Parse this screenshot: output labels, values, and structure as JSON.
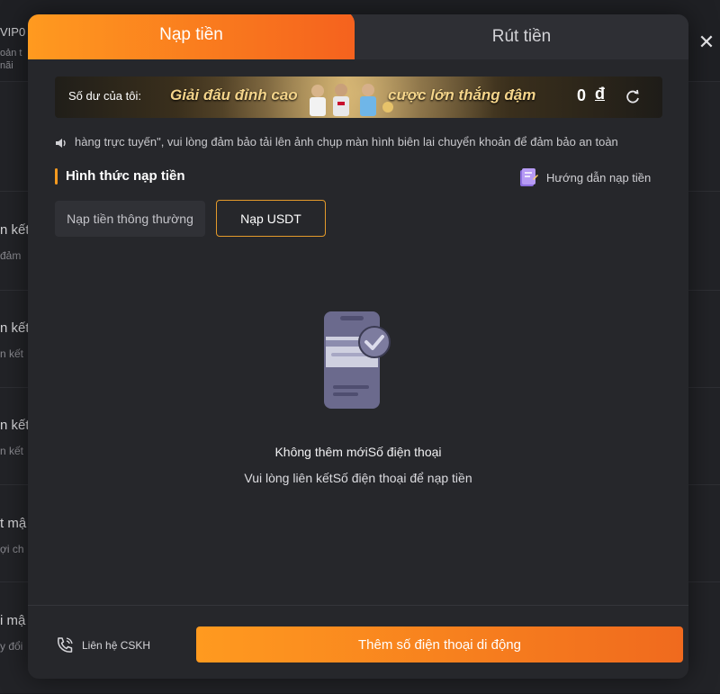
{
  "background": {
    "vip_label": "VIP0",
    "vip_sub_1": "oản t",
    "vip_sub_2": "nãi",
    "rows": [
      {
        "title": "n kết",
        "sub": "đảm"
      },
      {
        "title": "n kết",
        "sub": "n kết"
      },
      {
        "title": "n kết",
        "sub": "n kết"
      },
      {
        "title": "t mậ",
        "sub": "ợi ch"
      },
      {
        "title": "i mậ",
        "sub": "y đổi"
      }
    ],
    "close_symbol": "✕"
  },
  "tabs": {
    "deposit": "Nạp tiền",
    "withdraw": "Rút tiền"
  },
  "banner": {
    "balance_label": "Số dư của tôi:",
    "promo_left": "Giải đấu đỉnh cao",
    "promo_right": "cược lớn thắng đậm",
    "balance_value": "0",
    "currency": "đ"
  },
  "notice": {
    "text": "hàng trực tuyến\", vui lòng đảm bảo tải lên ảnh chụp màn hình biên lai chuyển khoản để đảm bảo an toàn"
  },
  "section": {
    "title": "Hình thức nạp tiền",
    "guide_label": "Hướng dẫn nạp tiền"
  },
  "methods": [
    {
      "label": "Nạp tiền thông thường",
      "selected": false
    },
    {
      "label": "Nạp USDT",
      "selected": true
    }
  ],
  "empty_state": {
    "title": "Không thêm mớiSố điện thoại",
    "description": "Vui lòng liên kếtSố điện thoại  để nạp tiền"
  },
  "footer": {
    "support_label": "Liên hệ CSKH",
    "add_button": "Thêm số điện thoại di động"
  },
  "colors": {
    "accent_start": "#ff9a1f",
    "accent_end": "#f06a1e",
    "modal_bg": "#26272b"
  }
}
